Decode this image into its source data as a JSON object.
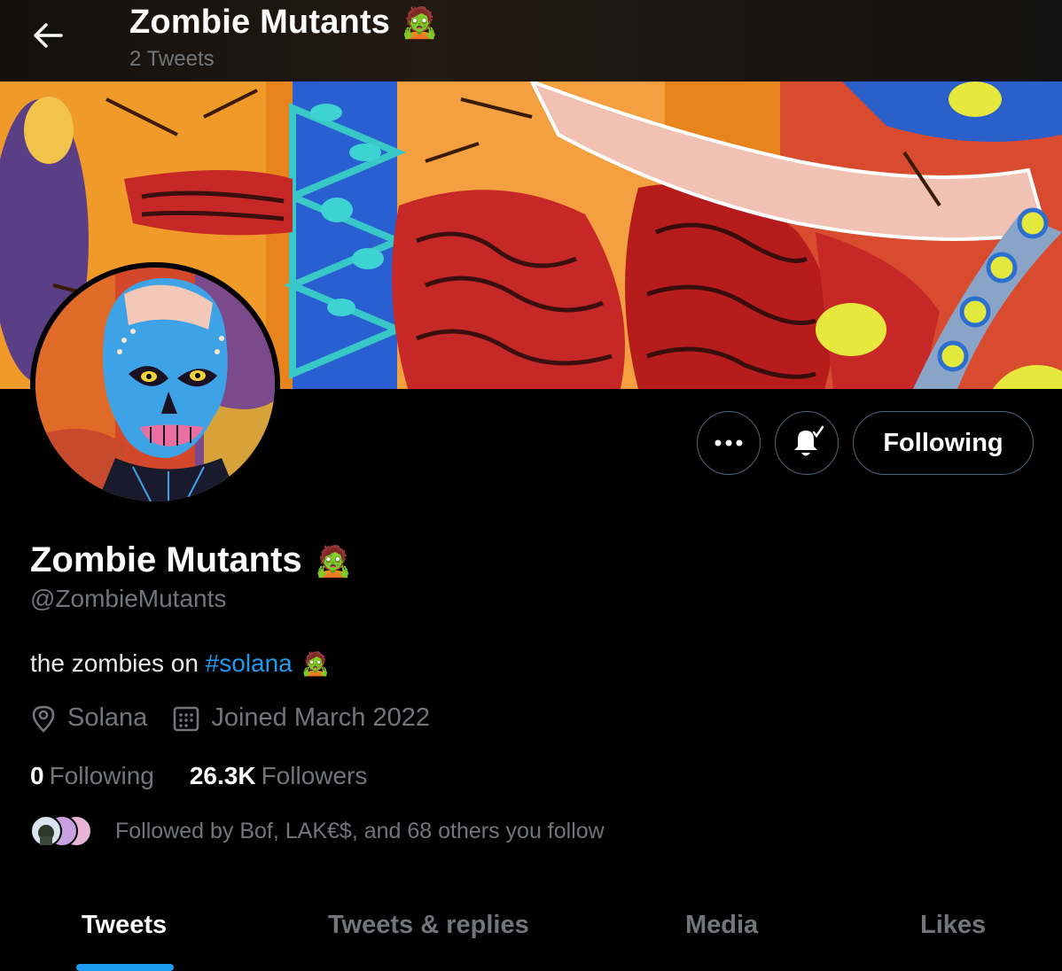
{
  "header": {
    "title": "Zombie Mutants",
    "title_emoji": "🧟",
    "tweet_count": "2 Tweets"
  },
  "profile": {
    "name": "Zombie Mutants",
    "name_emoji": "🧟",
    "handle": "@ZombieMutants",
    "bio_text": "the zombies on ",
    "bio_hashtag": "#solana",
    "bio_emoji": "🧟",
    "location": "Solana",
    "joined": "Joined March 2022",
    "following_count": "0",
    "following_label": "Following",
    "followers_count": "26.3K",
    "followers_label": "Followers",
    "followed_by": "Followed by Bof, LAK€$, and 68 others you follow"
  },
  "actions": {
    "following_label": "Following"
  },
  "tabs": [
    {
      "label": "Tweets"
    },
    {
      "label": "Tweets & replies"
    },
    {
      "label": "Media"
    },
    {
      "label": "Likes"
    }
  ],
  "colors": {
    "accent": "#1d9bf0",
    "background": "#000000",
    "muted": "#71767b"
  }
}
